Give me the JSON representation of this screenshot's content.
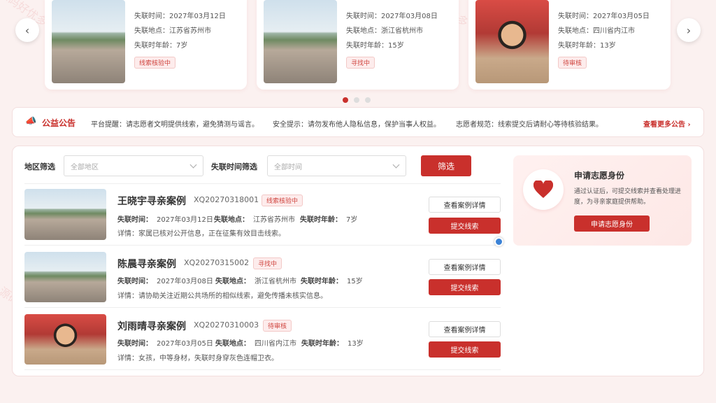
{
  "carousel": {
    "cards": [
      {
        "time_label": "失联时间：",
        "time": "2027年03月12日",
        "place_label": "失联地点：",
        "place": "江苏省苏州市",
        "age_label": "失联时年龄：",
        "age": "7岁",
        "status": "线索核验中"
      },
      {
        "time_label": "失联时间：",
        "time": "2027年03月08日",
        "place_label": "失联地点：",
        "place": "浙江省杭州市",
        "age_label": "失联时年龄：",
        "age": "15岁",
        "status": "寻找中"
      },
      {
        "time_label": "失联时间：",
        "time": "2027年03月05日",
        "place_label": "失联地点：",
        "place": "四川省内江市",
        "age_label": "失联时年龄：",
        "age": "13岁",
        "status": "待审核"
      }
    ],
    "prev_icon": "‹",
    "next_icon": "›",
    "active_dot": 0
  },
  "notice": {
    "icon": "📣",
    "title": "公益公告",
    "items": [
      "平台提醒：请志愿者文明提供线索，避免猜测与谣言。",
      "安全提示：请勿发布他人隐私信息，保护当事人权益。",
      "志愿者规范：线索提交后请耐心等待核验结果。"
    ],
    "more": "查看更多公告 ›"
  },
  "filter": {
    "region_label": "地区筛选",
    "region_placeholder": "全部地区",
    "time_label": "失联时间筛选",
    "time_placeholder": "全部时间",
    "button": "筛选"
  },
  "cases": [
    {
      "title": "王晓宇寻亲案例",
      "code": "XQ20270318001",
      "status": "线索核验中",
      "time_label": "失联时间：",
      "time": "2027年03月12日",
      "place_label": "失联地点：",
      "place": "江苏省苏州市",
      "age_label": "失联时年龄：",
      "age": "7岁",
      "detail": "详情：家属已核对公开信息，正在征集有效目击线索。",
      "view": "查看案例详情",
      "submit": "提交线索"
    },
    {
      "title": "陈晨寻亲案例",
      "code": "XQ20270315002",
      "status": "寻找中",
      "time_label": "失联时间：",
      "time": "2027年03月08日",
      "place_label": "失联地点：",
      "place": "浙江省杭州市",
      "age_label": "失联时年龄：",
      "age": "15岁",
      "detail": "详情：请协助关注近期公共场所的相似线索，避免传播未核实信息。",
      "view": "查看案例详情",
      "submit": "提交线索"
    },
    {
      "title": "刘雨晴寻亲案例",
      "code": "XQ20270310003",
      "status": "待审核",
      "time_label": "失联时间：",
      "time": "2027年03月05日",
      "place_label": "失联地点：",
      "place": "四川省内江市",
      "age_label": "失联时年龄：",
      "age": "13岁",
      "detail": "详情：女孩，中等身材，失联时身穿灰色连帽卫衣。",
      "view": "查看案例详情",
      "submit": "提交线索"
    }
  ],
  "volunteer": {
    "icon": "heart-icon",
    "title": "申请志愿身份",
    "desc": "通过认证后，可提交线索并查看处理进度，为寻亲家庭提供帮助。",
    "button": "申请志愿身份"
  },
  "watermark": "源码好优多",
  "colors": {
    "brand": "#c9302c",
    "bg": "#fbf1f0"
  }
}
